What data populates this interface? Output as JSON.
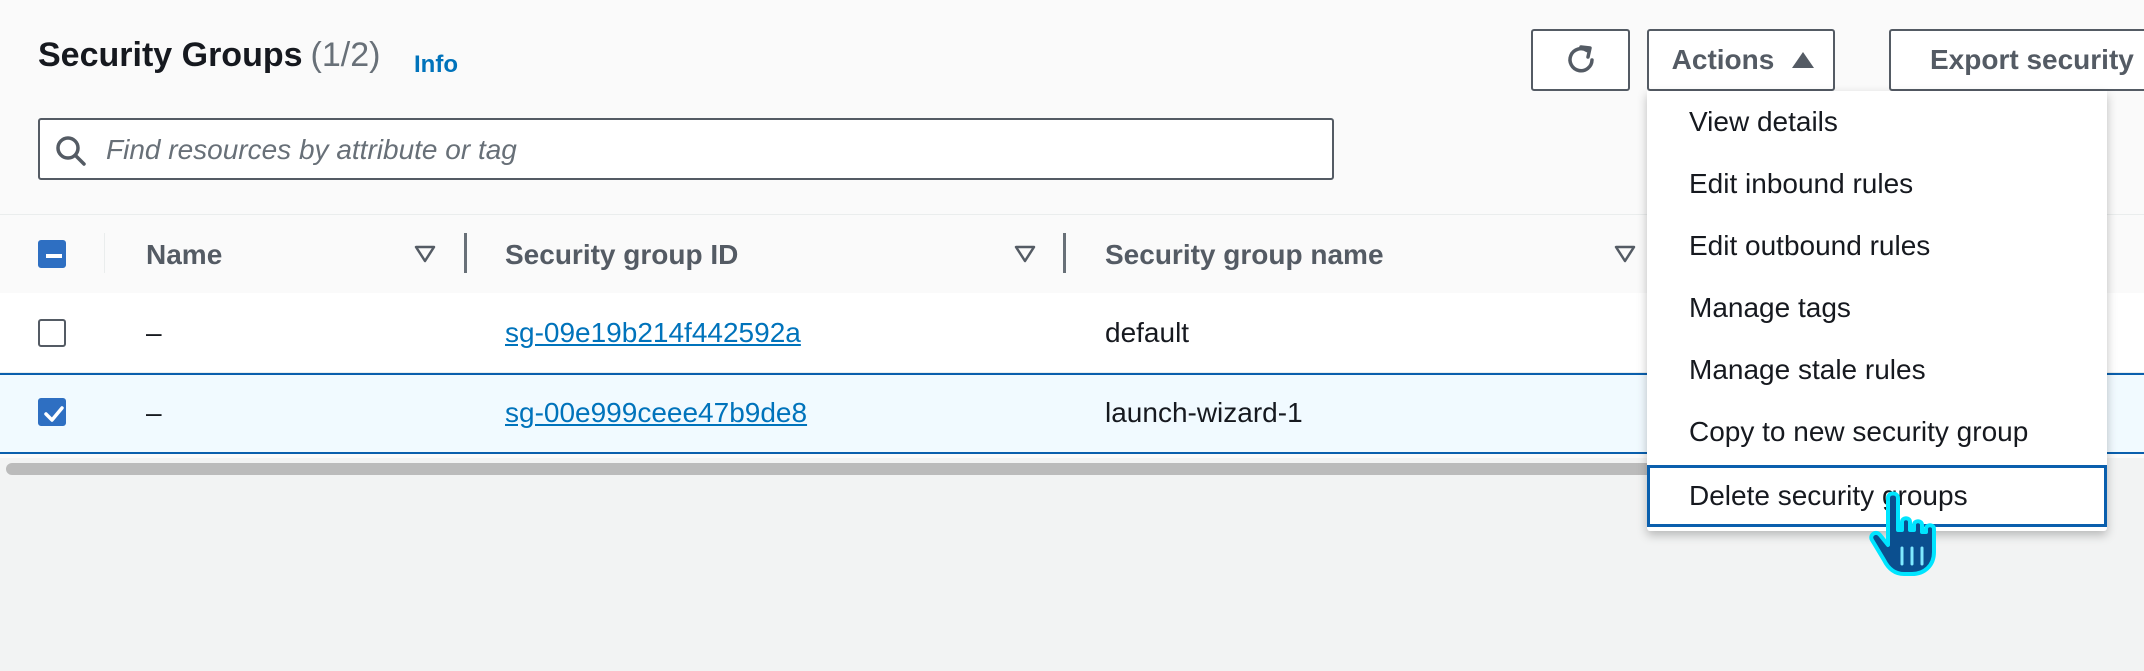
{
  "header": {
    "title": "Security Groups",
    "count": "(1/2)",
    "info_link": "Info"
  },
  "toolbar": {
    "refresh_icon": "refresh-icon",
    "actions_label": "Actions",
    "actions_caret_icon": "caret-up-icon",
    "export_label": "Export security"
  },
  "search": {
    "placeholder": "Find resources by attribute or tag",
    "icon": "search-icon"
  },
  "table": {
    "columns": [
      "Name",
      "Security group ID",
      "Security group name"
    ],
    "rows": [
      {
        "selected": false,
        "name": "–",
        "group_id": "sg-09e19b214f442592a",
        "group_name": "default"
      },
      {
        "selected": true,
        "name": "–",
        "group_id": "sg-00e999ceee47b9de8",
        "group_name": "launch-wizard-1"
      }
    ]
  },
  "actions_menu": {
    "items": [
      "View details",
      "Edit inbound rules",
      "Edit outbound rules",
      "Manage tags",
      "Manage stale rules",
      "Copy to new security group",
      "Delete security groups"
    ],
    "highlighted_index": 6
  },
  "colors": {
    "link": "#0073bb",
    "selection": "#0a5fad",
    "checkbox": "#2e6fc2"
  }
}
